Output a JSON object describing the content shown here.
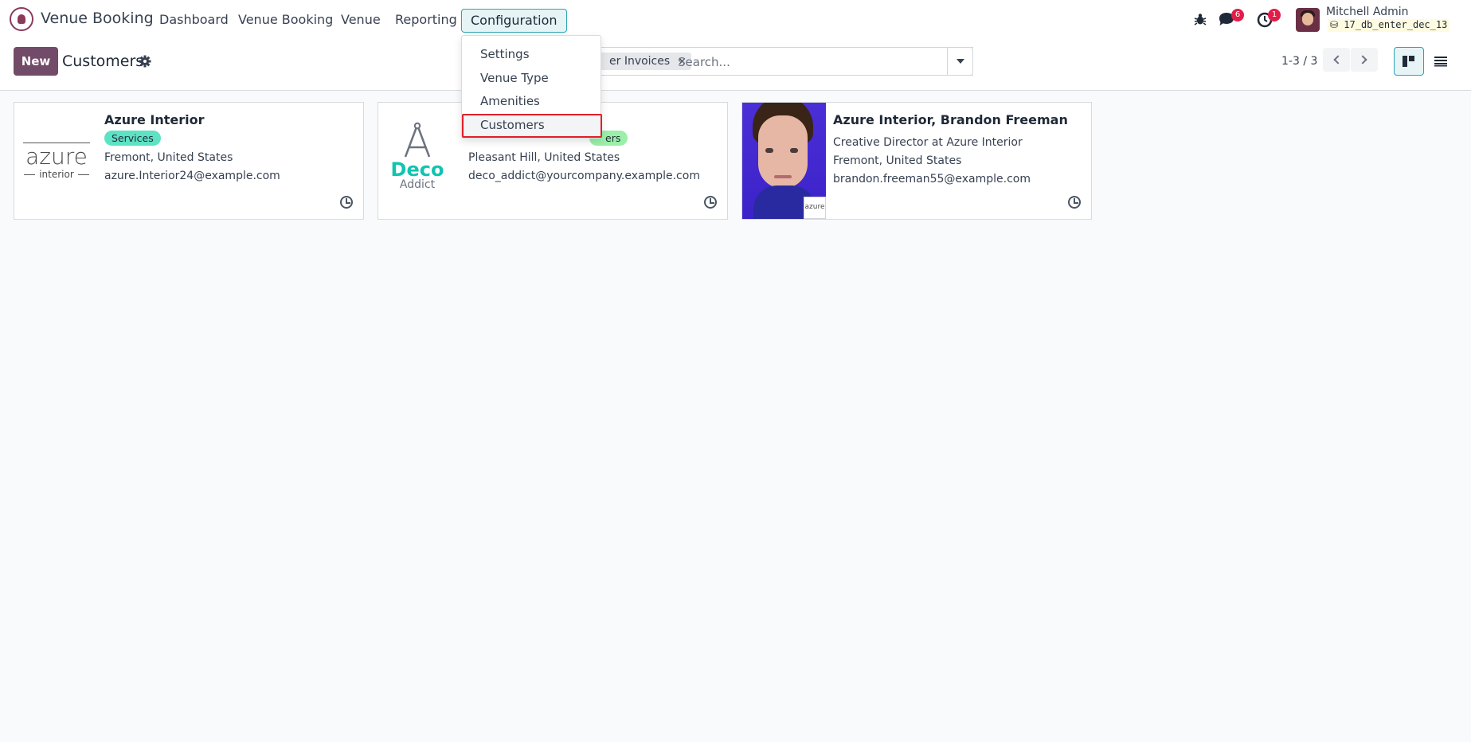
{
  "nav": {
    "app_name": "Venue Booking",
    "menu": [
      "Dashboard",
      "Venue Booking",
      "Venue",
      "Reporting",
      "Configuration"
    ]
  },
  "systray": {
    "messages_count": "6",
    "activities_count": "1",
    "user_name": "Mitchell Admin",
    "database": "17_db_enter_dec_13"
  },
  "control": {
    "new_label": "New",
    "title": "Customers",
    "facet": "er Invoices",
    "facet_remove": "×",
    "search_placeholder": "Search...",
    "pager": "1-3 / 3"
  },
  "config_menu": {
    "items": [
      "Settings",
      "Venue Type",
      "Amenities",
      "Customers"
    ],
    "highlighted": "Customers"
  },
  "cards": [
    {
      "name": "Azure Interior",
      "tag": "Services",
      "tag_color": "#5ee2c4",
      "location": "Fremont, United States",
      "email": "azure.Interior24@example.com",
      "logo": {
        "word": "azure",
        "sub": "interior"
      }
    },
    {
      "name": "",
      "tag": "ers",
      "tag_color": "#9af0a8",
      "location": "Pleasant Hill, United States",
      "email": "deco_addict@yourcompany.example.com",
      "logo": {
        "word": "Deco",
        "sub": "Addict"
      }
    },
    {
      "name": "Azure Interior, Brandon Freeman",
      "job": "Creative Director at Azure Interior",
      "location": "Fremont, United States",
      "email": "brandon.freeman55@example.com",
      "logo": {
        "mini": "azure"
      }
    }
  ],
  "colors": {
    "brand": "#714b67",
    "accent": "#2aa5b3",
    "highlight_border": "#e0202a",
    "badge": "#e11d48"
  }
}
